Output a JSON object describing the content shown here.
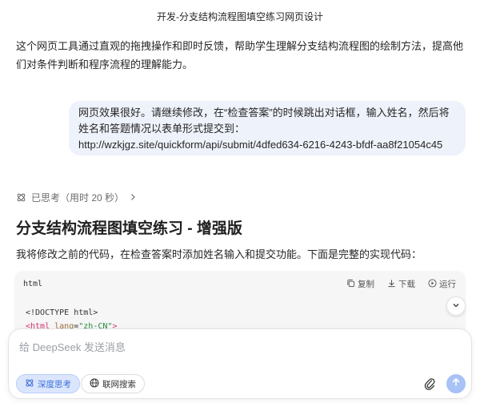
{
  "header": {
    "title": "开发-分支结构流程图填空练习网页设计"
  },
  "intro_text": "这个网页工具通过直观的拖拽操作和即时反馈，帮助学生理解分支结构流程图的绘制方法，提高他们对条件判断和程序流程的理解能力。",
  "user_message": {
    "text": "网页效果很好。请继续修改，在“检查答案”的时候跳出对话框，输入姓名，然后将姓名和答题情况以表单形式提交到：http://wzkjgz.site/quickform/api/submit/4dfed634-6216-4243-bfdf-aa8f21054c45"
  },
  "thinking": {
    "label": "已思考（用时 20 秒）",
    "icon": "deep-think-icon"
  },
  "response": {
    "heading": "分支结构流程图填空练习 - 增强版",
    "description": "我将修改之前的代码，在检查答案时添加姓名输入和提交功能。下面是完整的实现代码："
  },
  "code_block": {
    "language": "html",
    "copy_label": "复制",
    "download_label": "下载",
    "run_label": "运行",
    "lines": {
      "line1": "<!DOCTYPE html>",
      "line2_tag_open": "<html",
      "line2_attr": "lang",
      "line2_eq": "=",
      "line2_value": "\"zh-CN\"",
      "line2_close": ">"
    }
  },
  "composer": {
    "placeholder": "给 DeepSeek 发送消息",
    "deep_think_label": "深度思考",
    "web_search_label": "联网搜索"
  },
  "colors": {
    "accent": "#3b6fd8",
    "bubble_bg": "#eef2fb",
    "code_bg": "#f6f6f7",
    "send_disabled": "#a8c2f5"
  }
}
